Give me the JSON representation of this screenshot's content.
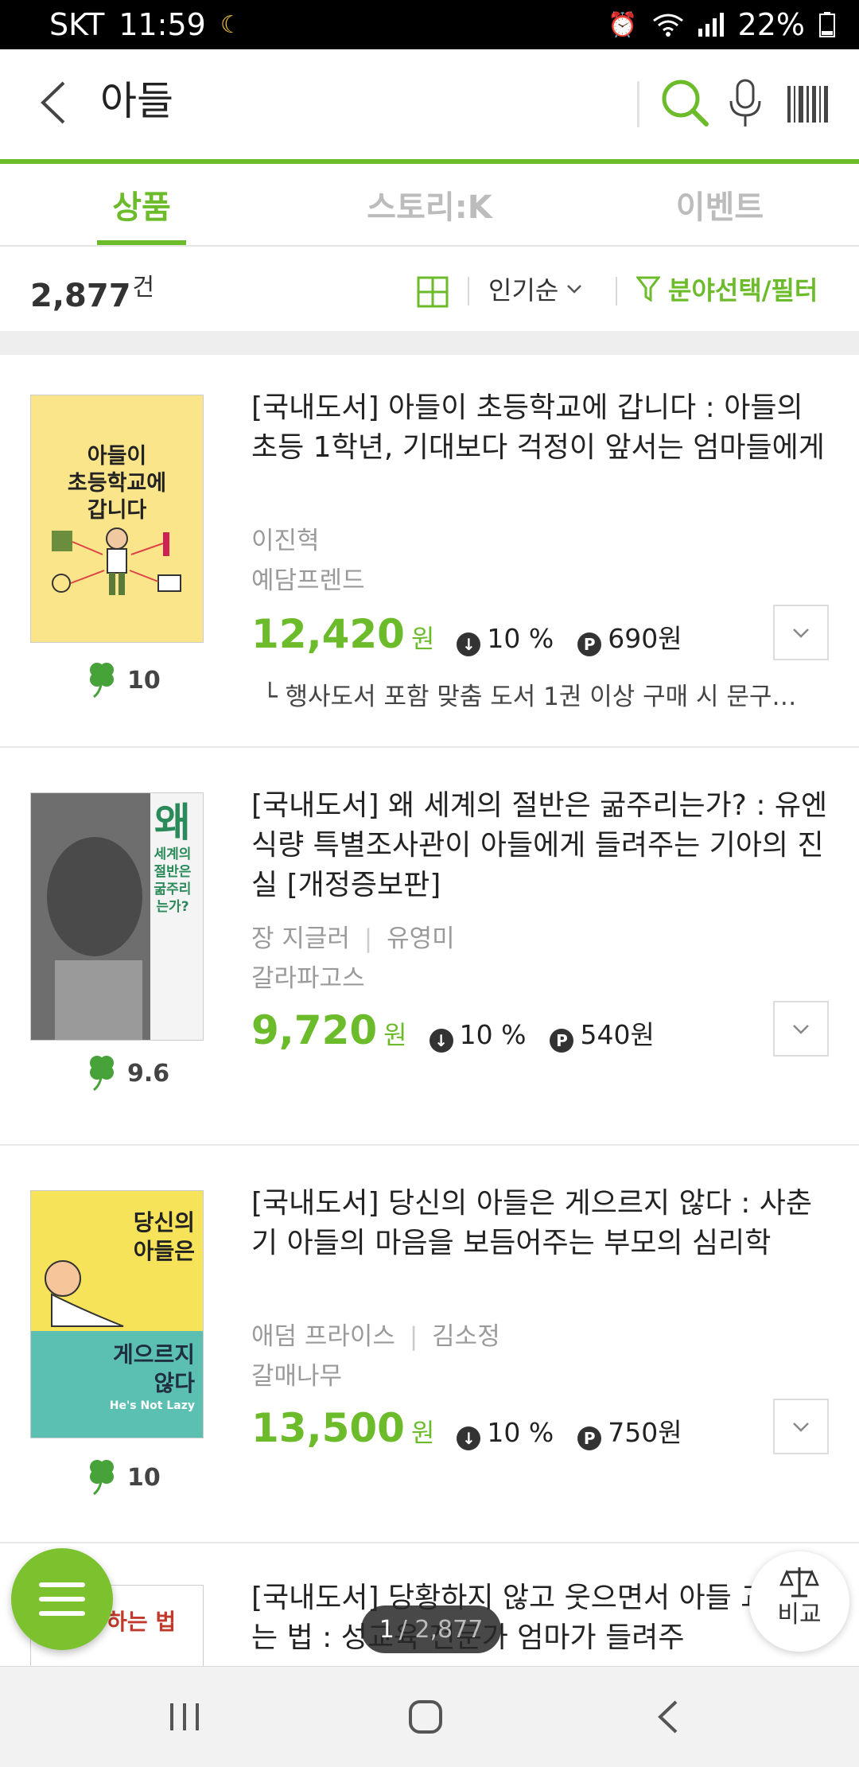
{
  "status": {
    "carrier": "SKT",
    "time": "11:59",
    "battery": "22%"
  },
  "search": {
    "query": "아들"
  },
  "tabs": [
    {
      "label": "상품"
    },
    {
      "label": "스토리:K"
    },
    {
      "label": "이벤트"
    }
  ],
  "toolbar": {
    "count": "2,877",
    "count_unit": "건",
    "sort": "인기순",
    "filter": "분야선택/필터"
  },
  "items": [
    {
      "cover_lines": [
        "아들이",
        "초등학교에",
        "갑니다"
      ],
      "rating": "10",
      "title": "[국내도서] 아들이 초등학교에 갑니다 : 아들의 초등 1학년, 기대보다 걱정이 앞서는 엄마들에게",
      "authors": [
        "이진혁"
      ],
      "publisher": "예담프렌드",
      "price": "12,420",
      "won": "원",
      "discount": "10 %",
      "points": "690원",
      "note": "└ 행사도서 포함 맞춤 도서 1권 이상 구매 시 문구…"
    },
    {
      "cover_lines": [
        "왜",
        "세계의",
        "절반은",
        "굶주리",
        "는가?"
      ],
      "rating": "9.6",
      "title": "[국내도서] 왜 세계의 절반은 굶주리는가? : 유엔 식량 특별조사관이 아들에게 들려주는 기아의 진실 [개정증보판]",
      "authors": [
        "장 지글러",
        "유영미"
      ],
      "publisher": "갈라파고스",
      "price": "9,720",
      "won": "원",
      "discount": "10 %",
      "points": "540원"
    },
    {
      "cover_lines": [
        "당신의",
        "아들은",
        "게으르지",
        "않다",
        "He's Not Lazy"
      ],
      "rating": "10",
      "title": "[국내도서] 당신의 아들은 게으르지 않다 : 사춘기 아들의 마음을 보듬어주는 부모의 심리학",
      "authors": [
        "애덤 프라이스",
        "김소정"
      ],
      "publisher": "갈매나무",
      "price": "13,500",
      "won": "원",
      "discount": "10 %",
      "points": "750원"
    },
    {
      "cover_lines": [
        "교육 하는 법"
      ],
      "title": "[국내도서] 당황하지 않고 웃으면서 아들 교육 하는 법 : 성교육 전문가 엄마가 들려주"
    }
  ],
  "pager": {
    "current": "1",
    "total": "/ 2,877"
  },
  "compare_label": "비교",
  "colors": {
    "accent": "#6cbb2b",
    "status_bar": "#000000"
  }
}
